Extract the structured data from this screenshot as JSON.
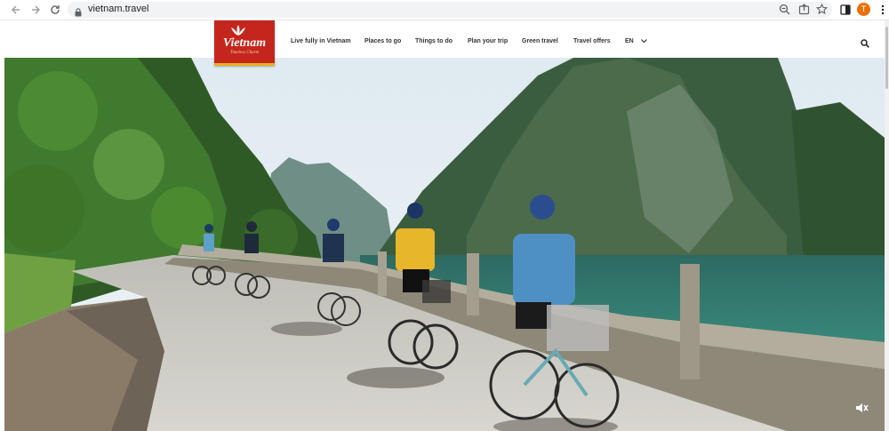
{
  "browser": {
    "url": "vietnam.travel",
    "profile_initial": "T",
    "profile_color": "#e8710a",
    "icons": [
      "back-icon",
      "forward-icon",
      "reload-icon",
      "lock-icon",
      "zoom-icon",
      "share-icon",
      "star-icon",
      "sidebar-icon",
      "menu-dots-icon"
    ]
  },
  "site": {
    "logo": {
      "text": "Vietnam",
      "tagline": "Timeless Charm"
    },
    "nav": [
      {
        "label": "Live fully in Vietnam"
      },
      {
        "label": "Places to go"
      },
      {
        "label": "Things to do"
      },
      {
        "label": "Plan your trip"
      },
      {
        "label": "Green travel"
      },
      {
        "label": "Travel offers"
      },
      {
        "label": "EN"
      }
    ],
    "brand_color": "#c4261d"
  },
  "hero": {
    "scene": "cyclists-on-coastal-road",
    "icons": [
      "mute-icon"
    ]
  }
}
